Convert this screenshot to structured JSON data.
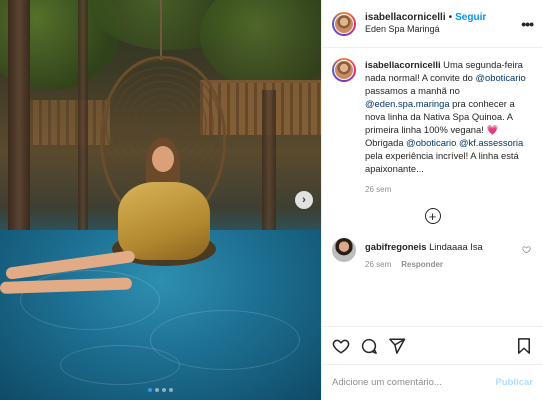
{
  "header": {
    "username": "isabellacornicelli",
    "separator": "•",
    "follow_label": "Seguir",
    "location": "Eden Spa Maringá",
    "more_icon": "more-horizontal-icon"
  },
  "caption": {
    "username": "isabellacornicelli",
    "parts": [
      {
        "t": "text",
        "v": "Uma segunda-feira nada normal! A convite do "
      },
      {
        "t": "mention",
        "v": "@oboticario"
      },
      {
        "t": "text",
        "v": " passamos a manhã no "
      },
      {
        "t": "mention",
        "v": "@eden.spa.maringa"
      },
      {
        "t": "text",
        "v": " pra conhecer a nova linha da Nativa Spa Quinoa. A primeira linha 100% vegana! "
      },
      {
        "t": "emoji",
        "v": "💗"
      },
      {
        "t": "text",
        "v": " Obrigada "
      },
      {
        "t": "mention",
        "v": "@oboticario"
      },
      {
        "t": "text",
        "v": " "
      },
      {
        "t": "mention",
        "v": "@kf.assessoria"
      },
      {
        "t": "text",
        "v": " pela experiência incrível! A linha está apaixonante..."
      }
    ],
    "time": "26 sem"
  },
  "load_more_icon": "plus-circle-icon",
  "comments": [
    {
      "username": "gabifregoneis",
      "text": "Lindaaaa Isa",
      "time": "26 sem",
      "reply_label": "Responder",
      "like_icon": "heart-outline-icon"
    }
  ],
  "actions": {
    "like_icon": "heart-outline-icon",
    "comment_icon": "comment-icon",
    "share_icon": "share-icon",
    "save_icon": "bookmark-icon"
  },
  "add_comment": {
    "placeholder": "Adicione um comentário...",
    "publish_label": "Publicar"
  },
  "carousel": {
    "next_icon": "chevron-right-icon",
    "total_slides": 4,
    "active_index": 0
  },
  "colors": {
    "link_blue": "#0095f6",
    "mention_blue": "#00376b",
    "muted": "#8e8e8e",
    "publish_disabled": "#b2dffc",
    "dot_active": "#3897f0"
  }
}
